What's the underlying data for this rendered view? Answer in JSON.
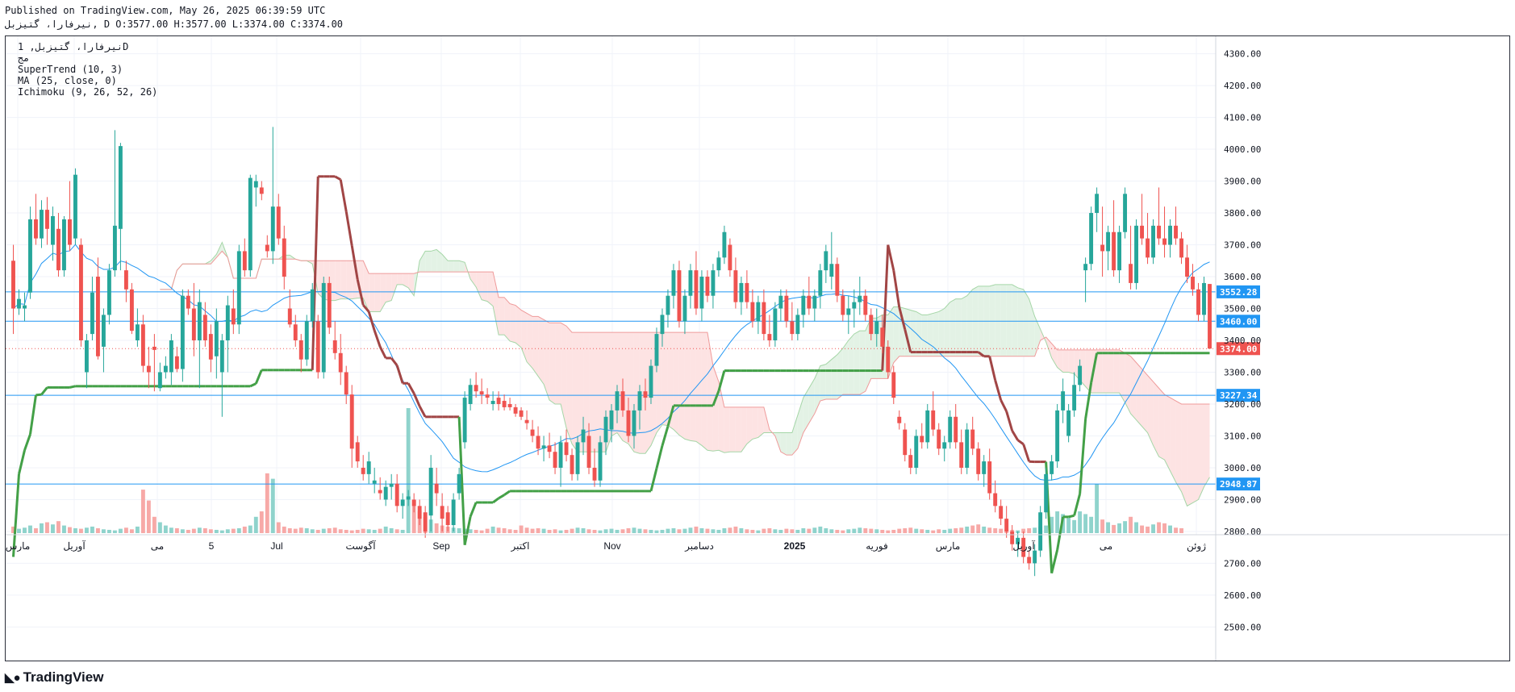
{
  "header": {
    "published": "Published on TradingView.com, May 26, 2025 06:39:59 UTC",
    "symbol_line": "نیرفارا، گتیزبل, D O:3577.00 H:3577.00 L:3374.00 C:3374.00"
  },
  "legend": {
    "title": "نیرفارا، گتیزبل, 1D",
    "subtitle": "مج",
    "indicators": [
      "SuperTrend (10, 3)",
      "MA (25, close, 0)",
      "Ichimoku (9, 26, 52, 26)"
    ]
  },
  "colors": {
    "up": "#26a69a",
    "down": "#ef5350",
    "vol_up": "#8fd3cc",
    "vol_down": "#f7a9a7",
    "supertrend_up": "#43a047",
    "supertrend_down": "#a14545",
    "ma": "#2196f3",
    "level_line": "#2196f3",
    "last_price": "#ef5350",
    "kumo_bull": "#e3f2e5",
    "kumo_bear": "#fde3e3"
  },
  "footer": {
    "brand": "TradingView",
    "logo_icon": "tradingview-logo-icon"
  },
  "chart_data": {
    "type": "candlestick",
    "ylim": [
      2420,
      4380
    ],
    "y_ticks": [
      "4300.00",
      "4200.00",
      "4100.00",
      "4000.00",
      "3900.00",
      "3800.00",
      "3700.00",
      "3600.00",
      "3500.00",
      "3400.00",
      "3300.00",
      "3200.00",
      "3100.00",
      "3000.00",
      "2900.00",
      "2800.00",
      "2700.00",
      "2600.00",
      "2500.00"
    ],
    "x_ticks": [
      "مارس",
      "آوریل",
      "مى",
      "5",
      "Jul",
      "آگوست",
      "Sep",
      "اکتبر",
      "Nov",
      "دسامبر",
      "2025",
      "فوریه",
      "مارس",
      "آوریل",
      "مى",
      "ژوئن"
    ],
    "x_tick_bold": "2025",
    "price_levels": [
      {
        "label": "3552.28",
        "value": 3552.28
      },
      {
        "label": "3460.00",
        "value": 3460.0
      },
      {
        "label": "3227.34",
        "value": 3227.34
      },
      {
        "label": "2948.87",
        "value": 2948.87
      }
    ],
    "last_price": {
      "label": "3374.00",
      "value": 3374.0
    },
    "candles": [
      [
        3650,
        3700,
        3420,
        3500
      ],
      [
        3500,
        3560,
        3480,
        3530
      ],
      [
        3500,
        3550,
        3460,
        3510
      ],
      [
        3550,
        3820,
        3530,
        3780
      ],
      [
        3780,
        3860,
        3700,
        3720
      ],
      [
        3720,
        3840,
        3690,
        3810
      ],
      [
        3810,
        3850,
        3700,
        3750
      ],
      [
        3700,
        3820,
        3650,
        3790
      ],
      [
        3750,
        3800,
        3600,
        3620
      ],
      [
        3620,
        3790,
        3600,
        3780
      ],
      [
        3780,
        3900,
        3680,
        3700
      ],
      [
        3720,
        3940,
        3700,
        3920
      ],
      [
        3700,
        3720,
        3380,
        3400
      ],
      [
        3300,
        3420,
        3250,
        3400
      ],
      [
        3420,
        3600,
        3400,
        3550
      ],
      [
        3600,
        3660,
        3340,
        3350
      ],
      [
        3380,
        3500,
        3300,
        3480
      ],
      [
        3480,
        3640,
        3450,
        3620
      ],
      [
        3620,
        4060,
        3600,
        3760
      ],
      [
        3750,
        4020,
        3620,
        4010
      ],
      [
        3620,
        3650,
        3520,
        3560
      ],
      [
        3560,
        3580,
        3420,
        3430
      ],
      [
        3400,
        3500,
        3380,
        3450
      ],
      [
        3450,
        3480,
        3300,
        3320
      ],
      [
        3320,
        3380,
        3250,
        3300
      ],
      [
        3380,
        3420,
        3240,
        3370
      ],
      [
        3250,
        3330,
        3240,
        3300
      ],
      [
        3300,
        3350,
        3280,
        3320
      ],
      [
        3300,
        3420,
        3260,
        3400
      ],
      [
        3350,
        3380,
        3300,
        3310
      ],
      [
        3310,
        3560,
        3270,
        3540
      ],
      [
        3540,
        3560,
        3480,
        3500
      ],
      [
        3500,
        3580,
        3350,
        3400
      ],
      [
        3400,
        3560,
        3250,
        3520
      ],
      [
        3480,
        3520,
        3380,
        3400
      ],
      [
        3420,
        3450,
        3300,
        3340
      ],
      [
        3350,
        3500,
        3280,
        3460
      ],
      [
        3300,
        3420,
        3160,
        3400
      ],
      [
        3400,
        3540,
        3300,
        3510
      ],
      [
        3500,
        3560,
        3420,
        3450
      ],
      [
        3450,
        3700,
        3420,
        3680
      ],
      [
        3680,
        3720,
        3600,
        3620
      ],
      [
        3620,
        3920,
        3600,
        3910
      ],
      [
        3880,
        3920,
        3820,
        3900
      ],
      [
        3880,
        3900,
        3840,
        3860
      ],
      [
        3700,
        3730,
        3660,
        3680
      ],
      [
        3680,
        4070,
        3640,
        3820
      ],
      [
        3820,
        3860,
        3700,
        3720
      ],
      [
        3720,
        3760,
        3560,
        3600
      ],
      [
        3500,
        3560,
        3440,
        3450
      ],
      [
        3450,
        3480,
        3380,
        3400
      ],
      [
        3400,
        3420,
        3300,
        3340
      ],
      [
        3340,
        3480,
        3320,
        3460
      ],
      [
        3460,
        3580,
        3440,
        3560
      ],
      [
        3460,
        3480,
        3280,
        3300
      ],
      [
        3300,
        3600,
        3280,
        3580
      ],
      [
        3580,
        3600,
        3420,
        3440
      ],
      [
        3400,
        3460,
        3340,
        3360
      ],
      [
        3360,
        3420,
        3260,
        3300
      ],
      [
        3300,
        3320,
        3200,
        3230
      ],
      [
        3230,
        3260,
        3000,
        3060
      ],
      [
        3080,
        3100,
        3000,
        3020
      ],
      [
        3000,
        3040,
        2960,
        2980
      ],
      [
        2980,
        3050,
        2950,
        3020
      ],
      [
        2950,
        3000,
        2920,
        2960
      ],
      [
        2930,
        2970,
        2900,
        2920
      ],
      [
        2900,
        2960,
        2880,
        2940
      ],
      [
        2940,
        2980,
        2900,
        2950
      ],
      [
        2950,
        2980,
        2860,
        2880
      ],
      [
        2880,
        2920,
        2840,
        2900
      ],
      [
        2900,
        2930,
        2880,
        2910
      ],
      [
        2900,
        2920,
        2860,
        2880
      ],
      [
        2880,
        2900,
        2820,
        2840
      ],
      [
        2860,
        2880,
        2780,
        2800
      ],
      [
        2850,
        3040,
        2800,
        3000
      ],
      [
        2950,
        3000,
        2880,
        2920
      ],
      [
        2880,
        2920,
        2800,
        2840
      ],
      [
        2860,
        2880,
        2800,
        2820
      ],
      [
        2820,
        2920,
        2800,
        2900
      ],
      [
        2920,
        3000,
        2900,
        2980
      ],
      [
        3080,
        3240,
        3060,
        3220
      ],
      [
        3200,
        3280,
        3180,
        3260
      ],
      [
        3260,
        3300,
        3220,
        3240
      ],
      [
        3240,
        3280,
        3200,
        3230
      ],
      [
        3230,
        3250,
        3200,
        3220
      ],
      [
        3200,
        3240,
        3180,
        3210
      ],
      [
        3220,
        3240,
        3180,
        3200
      ],
      [
        3210,
        3230,
        3180,
        3190
      ],
      [
        3200,
        3220,
        3180,
        3190
      ],
      [
        3190,
        3200,
        3160,
        3170
      ],
      [
        3180,
        3190,
        3150,
        3160
      ],
      [
        3150,
        3180,
        3120,
        3140
      ],
      [
        3120,
        3150,
        3080,
        3100
      ],
      [
        3100,
        3130,
        3040,
        3060
      ],
      [
        3060,
        3100,
        3020,
        3070
      ],
      [
        3070,
        3110,
        3030,
        3050
      ],
      [
        3050,
        3080,
        2980,
        3000
      ],
      [
        3000,
        3100,
        2940,
        3080
      ],
      [
        3080,
        3120,
        3020,
        3040
      ],
      [
        3040,
        3060,
        2960,
        2980
      ],
      [
        2980,
        3100,
        2960,
        3080
      ],
      [
        3080,
        3160,
        3040,
        3120
      ],
      [
        3100,
        3140,
        2980,
        3000
      ],
      [
        3000,
        3060,
        2940,
        2960
      ],
      [
        2960,
        3100,
        2940,
        3080
      ],
      [
        3080,
        3180,
        3040,
        3160
      ],
      [
        3120,
        3200,
        3080,
        3180
      ],
      [
        3180,
        3260,
        3140,
        3240
      ],
      [
        3240,
        3280,
        3160,
        3180
      ],
      [
        3180,
        3220,
        3080,
        3100
      ],
      [
        3100,
        3200,
        3060,
        3180
      ],
      [
        3180,
        3260,
        3120,
        3240
      ],
      [
        3240,
        3280,
        3180,
        3220
      ],
      [
        3220,
        3340,
        3200,
        3320
      ],
      [
        3320,
        3440,
        3300,
        3420
      ],
      [
        3420,
        3500,
        3380,
        3480
      ],
      [
        3480,
        3560,
        3440,
        3540
      ],
      [
        3540,
        3640,
        3500,
        3620
      ],
      [
        3620,
        3650,
        3440,
        3460
      ],
      [
        3460,
        3560,
        3420,
        3540
      ],
      [
        3540,
        3640,
        3500,
        3620
      ],
      [
        3620,
        3680,
        3480,
        3500
      ],
      [
        3500,
        3620,
        3460,
        3600
      ],
      [
        3600,
        3620,
        3520,
        3540
      ],
      [
        3540,
        3640,
        3500,
        3620
      ],
      [
        3620,
        3680,
        3600,
        3660
      ],
      [
        3660,
        3760,
        3640,
        3740
      ],
      [
        3700,
        3720,
        3600,
        3620
      ],
      [
        3620,
        3660,
        3500,
        3520
      ],
      [
        3520,
        3600,
        3480,
        3580
      ],
      [
        3580,
        3620,
        3500,
        3520
      ],
      [
        3520,
        3560,
        3440,
        3460
      ],
      [
        3460,
        3540,
        3420,
        3520
      ],
      [
        3520,
        3560,
        3400,
        3420
      ],
      [
        3420,
        3480,
        3380,
        3400
      ],
      [
        3400,
        3520,
        3380,
        3500
      ],
      [
        3500,
        3560,
        3460,
        3540
      ],
      [
        3540,
        3560,
        3440,
        3460
      ],
      [
        3460,
        3520,
        3400,
        3420
      ],
      [
        3420,
        3500,
        3400,
        3480
      ],
      [
        3480,
        3560,
        3440,
        3540
      ],
      [
        3540,
        3600,
        3480,
        3500
      ],
      [
        3500,
        3560,
        3460,
        3540
      ],
      [
        3540,
        3640,
        3500,
        3620
      ],
      [
        3620,
        3700,
        3580,
        3680
      ],
      [
        3600,
        3740,
        3560,
        3640
      ],
      [
        3640,
        3660,
        3520,
        3540
      ],
      [
        3540,
        3560,
        3460,
        3480
      ],
      [
        3480,
        3540,
        3420,
        3500
      ],
      [
        3500,
        3560,
        3440,
        3520
      ],
      [
        3520,
        3600,
        3480,
        3540
      ],
      [
        3540,
        3560,
        3460,
        3480
      ],
      [
        3480,
        3500,
        3400,
        3420
      ],
      [
        3420,
        3500,
        3380,
        3460
      ],
      [
        3440,
        3480,
        3360,
        3380
      ],
      [
        3380,
        3400,
        3280,
        3300
      ],
      [
        3300,
        3320,
        3200,
        3220
      ],
      [
        3160,
        3180,
        3120,
        3140
      ],
      [
        3120,
        3140,
        3020,
        3040
      ],
      [
        3040,
        3060,
        2980,
        3000
      ],
      [
        3000,
        3120,
        2980,
        3100
      ],
      [
        3100,
        3140,
        3060,
        3080
      ],
      [
        3080,
        3200,
        3060,
        3180
      ],
      [
        3180,
        3240,
        3100,
        3120
      ],
      [
        3120,
        3140,
        3040,
        3060
      ],
      [
        3060,
        3100,
        3020,
        3080
      ],
      [
        3080,
        3180,
        3060,
        3160
      ],
      [
        3160,
        3200,
        3060,
        3080
      ],
      [
        3080,
        3120,
        2980,
        3000
      ],
      [
        3000,
        3140,
        2980,
        3120
      ],
      [
        3120,
        3160,
        3040,
        3060
      ],
      [
        3060,
        3080,
        2960,
        2980
      ],
      [
        2980,
        3040,
        2940,
        3020
      ],
      [
        3020,
        3060,
        2900,
        2920
      ],
      [
        2920,
        2960,
        2860,
        2880
      ],
      [
        2880,
        2900,
        2820,
        2840
      ],
      [
        2840,
        2880,
        2780,
        2800
      ],
      [
        2800,
        2820,
        2740,
        2760
      ],
      [
        2760,
        2800,
        2720,
        2780
      ],
      [
        2780,
        2800,
        2700,
        2720
      ],
      [
        2720,
        2740,
        2680,
        2700
      ],
      [
        2700,
        2760,
        2660,
        2740
      ],
      [
        2740,
        2880,
        2720,
        2860
      ],
      [
        2860,
        3000,
        2840,
        2980
      ],
      [
        2980,
        3040,
        2960,
        3020
      ],
      [
        3020,
        3200,
        3000,
        3180
      ],
      [
        3180,
        3280,
        3140,
        3240
      ],
      [
        3100,
        3200,
        3080,
        3180
      ],
      [
        3180,
        3300,
        3160,
        3260
      ],
      [
        3260,
        3340,
        3240,
        3320
      ],
      [
        3620,
        3660,
        3520,
        3640
      ],
      [
        3640,
        3820,
        3620,
        3800
      ],
      [
        3800,
        3880,
        3740,
        3860
      ],
      [
        3700,
        3820,
        3600,
        3680
      ],
      [
        3680,
        3760,
        3620,
        3740
      ],
      [
        3740,
        3840,
        3600,
        3620
      ],
      [
        3620,
        3760,
        3580,
        3740
      ],
      [
        3740,
        3880,
        3720,
        3860
      ],
      [
        3640,
        3760,
        3560,
        3580
      ],
      [
        3580,
        3780,
        3560,
        3760
      ],
      [
        3760,
        3860,
        3700,
        3720
      ],
      [
        3720,
        3800,
        3640,
        3660
      ],
      [
        3660,
        3780,
        3640,
        3760
      ],
      [
        3760,
        3880,
        3700,
        3720
      ],
      [
        3720,
        3820,
        3660,
        3700
      ],
      [
        3700,
        3780,
        3660,
        3760
      ],
      [
        3760,
        3820,
        3700,
        3720
      ],
      [
        3720,
        3740,
        3640,
        3660
      ],
      [
        3660,
        3700,
        3580,
        3600
      ],
      [
        3600,
        3640,
        3540,
        3560
      ],
      [
        3560,
        3580,
        3460,
        3480
      ],
      [
        3480,
        3600,
        3460,
        3580
      ],
      [
        3577,
        3577,
        3374,
        3374
      ]
    ],
    "volume": [
      12,
      8,
      10,
      14,
      9,
      18,
      20,
      16,
      22,
      14,
      11,
      9,
      8,
      10,
      12,
      9,
      7,
      6,
      5,
      8,
      10,
      7,
      12,
      80,
      60,
      30,
      20,
      14,
      10,
      9,
      7,
      6,
      8,
      10,
      9,
      7,
      6,
      5,
      7,
      8,
      9,
      12,
      14,
      30,
      40,
      110,
      100,
      20,
      12,
      9,
      8,
      10,
      9,
      7,
      6,
      8,
      9,
      10,
      7,
      6,
      5,
      6,
      8,
      7,
      6,
      8,
      12,
      9,
      7,
      6,
      230,
      60,
      40,
      30,
      25,
      18,
      14,
      12,
      10,
      9,
      8,
      7,
      6,
      5,
      8,
      12,
      10,
      9,
      7,
      6,
      14,
      10,
      8,
      9,
      8,
      6,
      7,
      5,
      6,
      8,
      10,
      9,
      7,
      6,
      5,
      7,
      8,
      6,
      7,
      9,
      10,
      8,
      7,
      6,
      5,
      6,
      8,
      9,
      7,
      8,
      10,
      12,
      9,
      8,
      7,
      6,
      9,
      10,
      12,
      9,
      7,
      6,
      5,
      8,
      9,
      7,
      6,
      8,
      7,
      6,
      9,
      8,
      10,
      12,
      9,
      7,
      6,
      5,
      7,
      8,
      10,
      9,
      8,
      7,
      6,
      5,
      6,
      8,
      9,
      10,
      8,
      7,
      6,
      5,
      7,
      6,
      8,
      9,
      10,
      12,
      14,
      16,
      12,
      10,
      9,
      8,
      7,
      6,
      5,
      8,
      9,
      10,
      12,
      14,
      30,
      40,
      35,
      28,
      24,
      40,
      35,
      30,
      90,
      25,
      20,
      15,
      18,
      22,
      30,
      20,
      14,
      12,
      16,
      20,
      18,
      14,
      10,
      9
    ]
  }
}
